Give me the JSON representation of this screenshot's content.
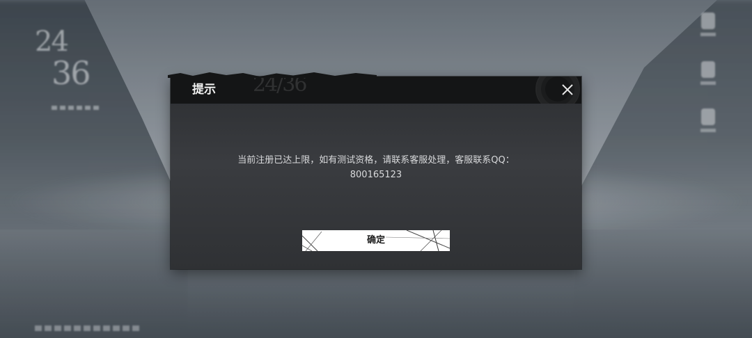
{
  "background": {
    "logo_top": "24",
    "logo_bottom": "36",
    "side_buttons": [
      "notice-icon",
      "mail-icon",
      "home-icon"
    ]
  },
  "dialog": {
    "title": "提示",
    "watermark": "24/36",
    "message_line1": "当前注册已达上限，如有测试资格，请联系客服处理，客服联系QQ：",
    "message_line2": "800165123",
    "confirm_label": "确定",
    "close_icon": "close-icon"
  },
  "colors": {
    "dialog_header": "#141516",
    "dialog_body": "#3a3c40",
    "button_bg": "#ffffff",
    "text_light": "#d9dadc"
  }
}
